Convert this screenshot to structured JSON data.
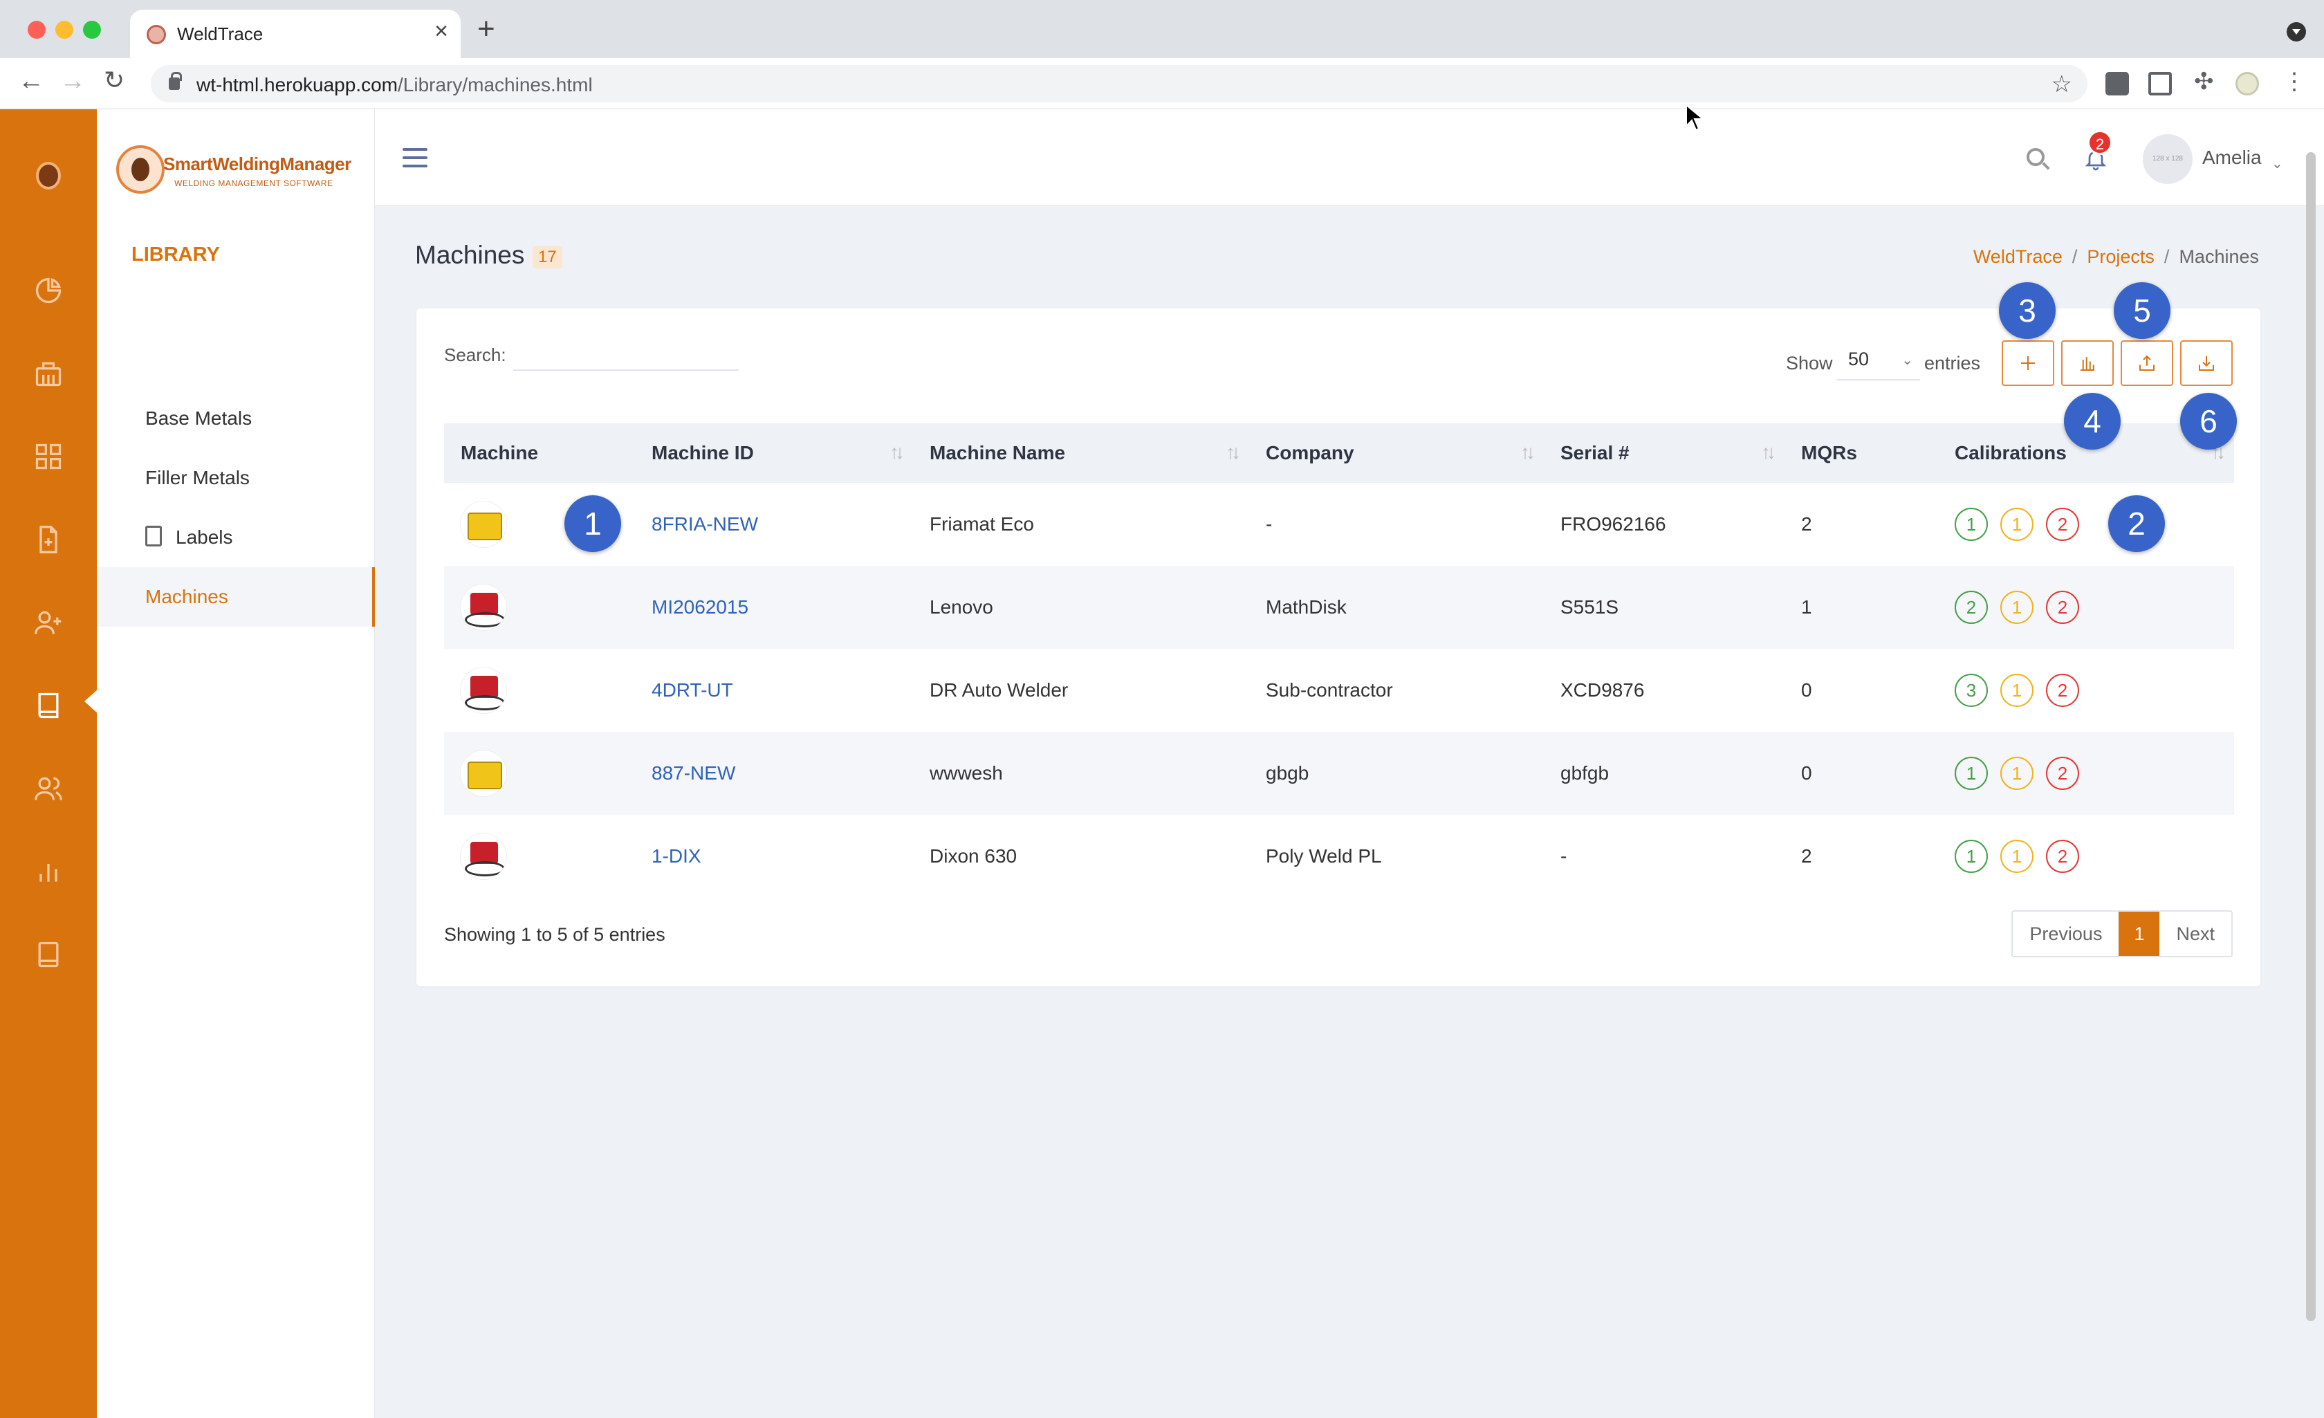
{
  "browser": {
    "tab_title": "WeldTrace",
    "url_host": "wt-html.herokuapp.com",
    "url_path": "/Library/machines.html"
  },
  "brand": {
    "name": "SmartWeldingManager",
    "tagline": "WELDING MANAGEMENT SOFTWARE"
  },
  "sidebar": {
    "section_title": "LIBRARY",
    "items": [
      {
        "label": "Base Metals"
      },
      {
        "label": "Filler Metals"
      },
      {
        "label": "Labels"
      },
      {
        "label": "Machines"
      }
    ]
  },
  "header": {
    "notification_count": "2",
    "avatar_placeholder": "128 x 128",
    "user_name": "Amelia"
  },
  "page": {
    "title": "Machines",
    "count": "17",
    "breadcrumb": [
      "WeldTrace",
      "Projects",
      "Machines"
    ]
  },
  "controls": {
    "search_label": "Search:",
    "search_value": "",
    "show_label": "Show",
    "entries_value": "50",
    "entries_label": "entries"
  },
  "table": {
    "columns": [
      "Machine",
      "Machine ID",
      "Machine Name",
      "Company",
      "Serial #",
      "MQRs",
      "Calibrations"
    ],
    "rows": [
      {
        "id": "8FRIA-NEW",
        "name": "Friamat Eco",
        "company": "-",
        "serial": "FRO962166",
        "mqrs": "2",
        "cal": [
          "1",
          "1",
          "2"
        ]
      },
      {
        "id": "MI2062015",
        "name": "Lenovo",
        "company": "MathDisk",
        "serial": "S551S",
        "mqrs": "1",
        "cal": [
          "2",
          "1",
          "2"
        ]
      },
      {
        "id": "4DRT-UT",
        "name": "DR Auto Welder",
        "company": "Sub-contractor",
        "serial": "XCD9876",
        "mqrs": "0",
        "cal": [
          "3",
          "1",
          "2"
        ]
      },
      {
        "id": "887-NEW",
        "name": "wwwesh",
        "company": "gbgb",
        "serial": "gbfgb",
        "mqrs": "0",
        "cal": [
          "1",
          "1",
          "2"
        ]
      },
      {
        "id": "1-DIX",
        "name": "Dixon 630",
        "company": "Poly Weld PL",
        "serial": "-",
        "mqrs": "2",
        "cal": [
          "1",
          "1",
          "2"
        ]
      }
    ]
  },
  "footer": {
    "showing": "Showing 1 to 5 of 5 entries",
    "previous": "Previous",
    "page": "1",
    "next": "Next"
  },
  "markers": [
    "1",
    "2",
    "3",
    "4",
    "5",
    "6"
  ],
  "colors": {
    "accent": "#d9730d",
    "link": "#2f63b8",
    "marker": "#3864c9",
    "cal_green": "#43a047",
    "cal_yellow": "#f2b21b",
    "cal_red": "#e53935"
  }
}
